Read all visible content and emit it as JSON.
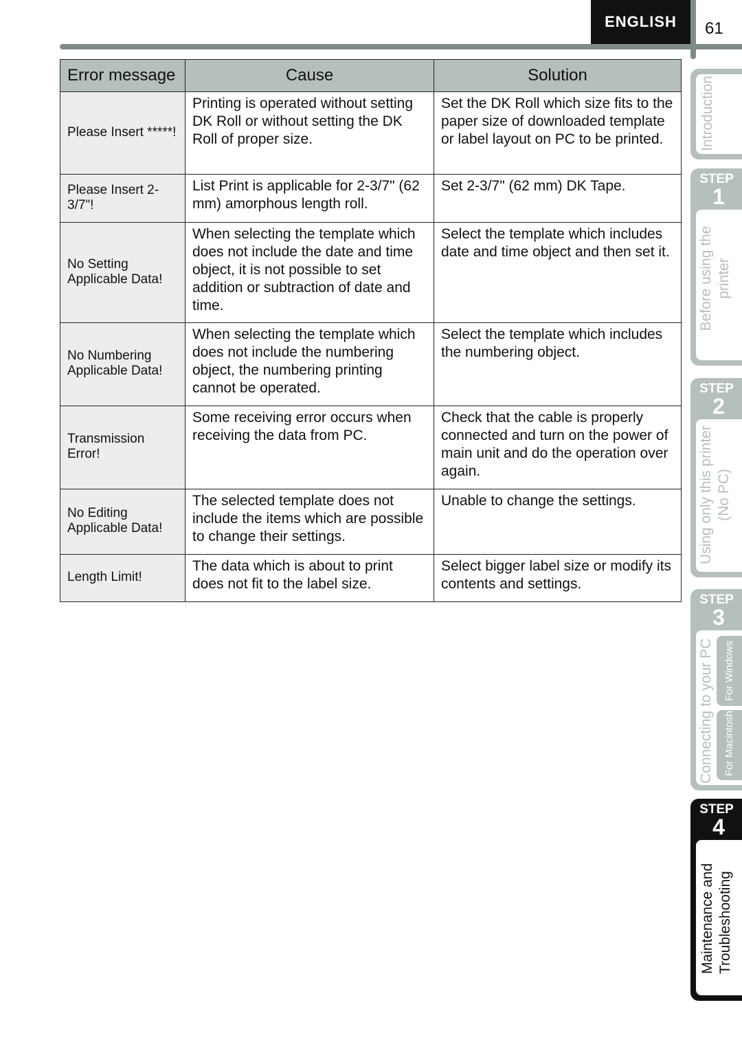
{
  "header": {
    "language": "ENGLISH",
    "page_number": "61"
  },
  "table": {
    "columns": [
      "Error message",
      "Cause",
      "Solution"
    ],
    "rows": [
      {
        "error": "Please Insert *****!",
        "cause": "Printing is operated without setting DK Roll or without setting the DK Roll of proper size.",
        "solution": "Set the DK Roll which size fits to the paper size of downloaded template or label layout on PC to be printed."
      },
      {
        "error": "Please Insert 2-3/7\"!",
        "cause": "List Print is applicable for 2-3/7\" (62 mm) amorphous length roll.",
        "solution": "Set 2-3/7\" (62 mm) DK Tape."
      },
      {
        "error": "No Setting Applicable Data!",
        "cause": "When selecting the template which does not include the date and time object, it is not possible to set addition or subtraction of date and time.",
        "solution": "Select the template which includes date and time object and then set it."
      },
      {
        "error": "No Numbering Applicable Data!",
        "cause": "When selecting the template which does not include the numbering object, the numbering printing cannot be operated.",
        "solution": "Select the template which includes the numbering object."
      },
      {
        "error": "Transmission Error!",
        "cause": "Some receiving error occurs when receiving the data from PC.",
        "solution": "Check that the cable is properly connected and turn on the power of main unit and do the operation over again."
      },
      {
        "error": "No Editing Applicable Data!",
        "cause": "The selected template does not include the items which are possible to change their settings.",
        "solution": "Unable to change the settings."
      },
      {
        "error": "Length Limit!",
        "cause": "The data which is about to print does not fit to the label size.",
        "solution": "Select bigger label size or modify its contents and settings."
      }
    ]
  },
  "sidebar": {
    "step_label": "STEP",
    "intro": "Introduction",
    "step1": {
      "number": "1",
      "line1": "Before using the",
      "line2": "printer"
    },
    "step2": {
      "number": "2",
      "line1": "Using only this printer",
      "line2": "(No PC)"
    },
    "step3": {
      "number": "3",
      "title": "Connecting to your PC",
      "windows": "For Windows",
      "mac": "For Macintosh"
    },
    "step4": {
      "number": "4",
      "line1": "Maintenance and",
      "line2": "Troubleshooting"
    },
    "colors": {
      "tab_gray": "#b5bfbe",
      "active": "#111111"
    }
  }
}
